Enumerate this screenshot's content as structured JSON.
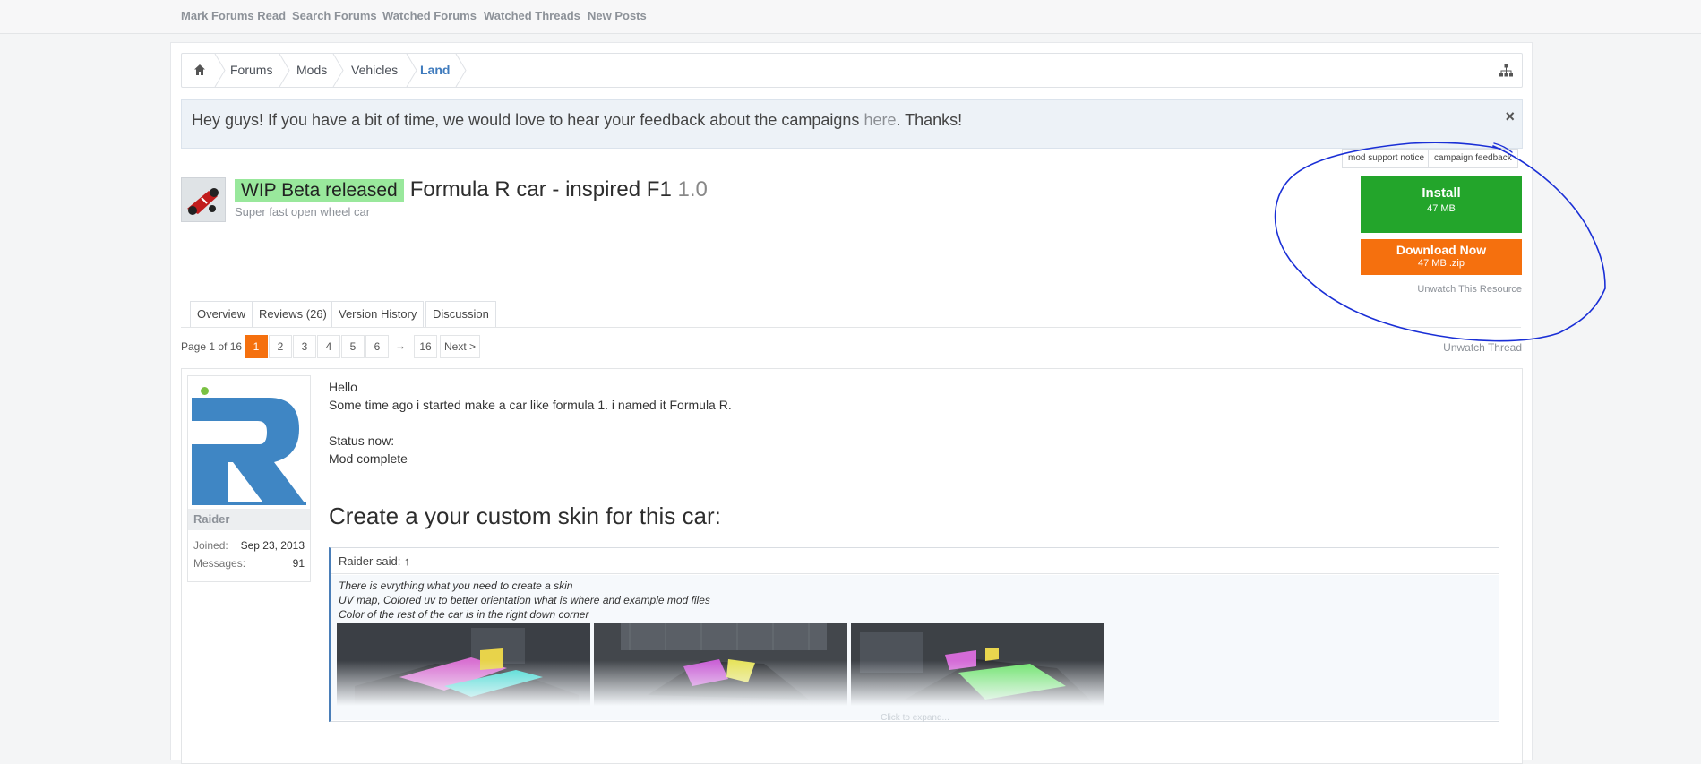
{
  "topnav": {
    "items": [
      "Mark Forums Read",
      "Search Forums",
      "Watched Forums",
      "Watched Threads",
      "New Posts"
    ]
  },
  "breadcrumb": {
    "items": [
      "Forums",
      "Mods",
      "Vehicles"
    ],
    "active": "Land"
  },
  "notice": {
    "text_before": "Hey guys! If you have a bit of time, we would love to hear your feedback about the campaigns ",
    "link": "here",
    "text_after": ". Thanks!",
    "close": "×"
  },
  "notice_tags": [
    "mod support notice",
    "campaign feedback"
  ],
  "resource": {
    "prefix": "WIP Beta released",
    "title": "Formula R car - inspired F1",
    "version": "1.0",
    "tagline": "Super fast open wheel car"
  },
  "actions": {
    "install_label": "Install",
    "install_size": "47 MB",
    "download_label": "Download Now",
    "download_size": "47 MB .zip",
    "unwatch_resource": "Unwatch This Resource"
  },
  "tabs": [
    "Overview",
    "Reviews (26)",
    "Version History",
    "Discussion"
  ],
  "pager": {
    "label": "Page 1 of 16",
    "pages": [
      "1",
      "2",
      "3",
      "4",
      "5",
      "6"
    ],
    "arrow": "→",
    "last": "16",
    "next": "Next >",
    "current": 1,
    "unwatch_thread": "Unwatch Thread"
  },
  "post": {
    "user": {
      "name": "Raider",
      "joined_label": "Joined:",
      "joined": "Sep 23, 2013",
      "messages_label": "Messages:",
      "messages": "91"
    },
    "lines": [
      "Hello",
      "Some time ago i started make a car like formula 1. i named it Formula R.",
      "Status now:",
      "Mod complete"
    ],
    "heading": "Create a your custom skin for this car:",
    "quote": {
      "author": "Raider said: ↑",
      "lines": [
        "There is evrything what you need to create a skin",
        "UV map, Colored uv to better orientation what is where and example mod files",
        "Color of the rest of the car is in the right down corner"
      ],
      "expand": "Click to expand..."
    }
  },
  "colors": {
    "accent_orange": "#f5700e",
    "install_green": "#23a52b",
    "prefix_green": "#99e89c",
    "link_blue": "#3f7bbd",
    "annotation_blue": "#1a2fd6"
  }
}
